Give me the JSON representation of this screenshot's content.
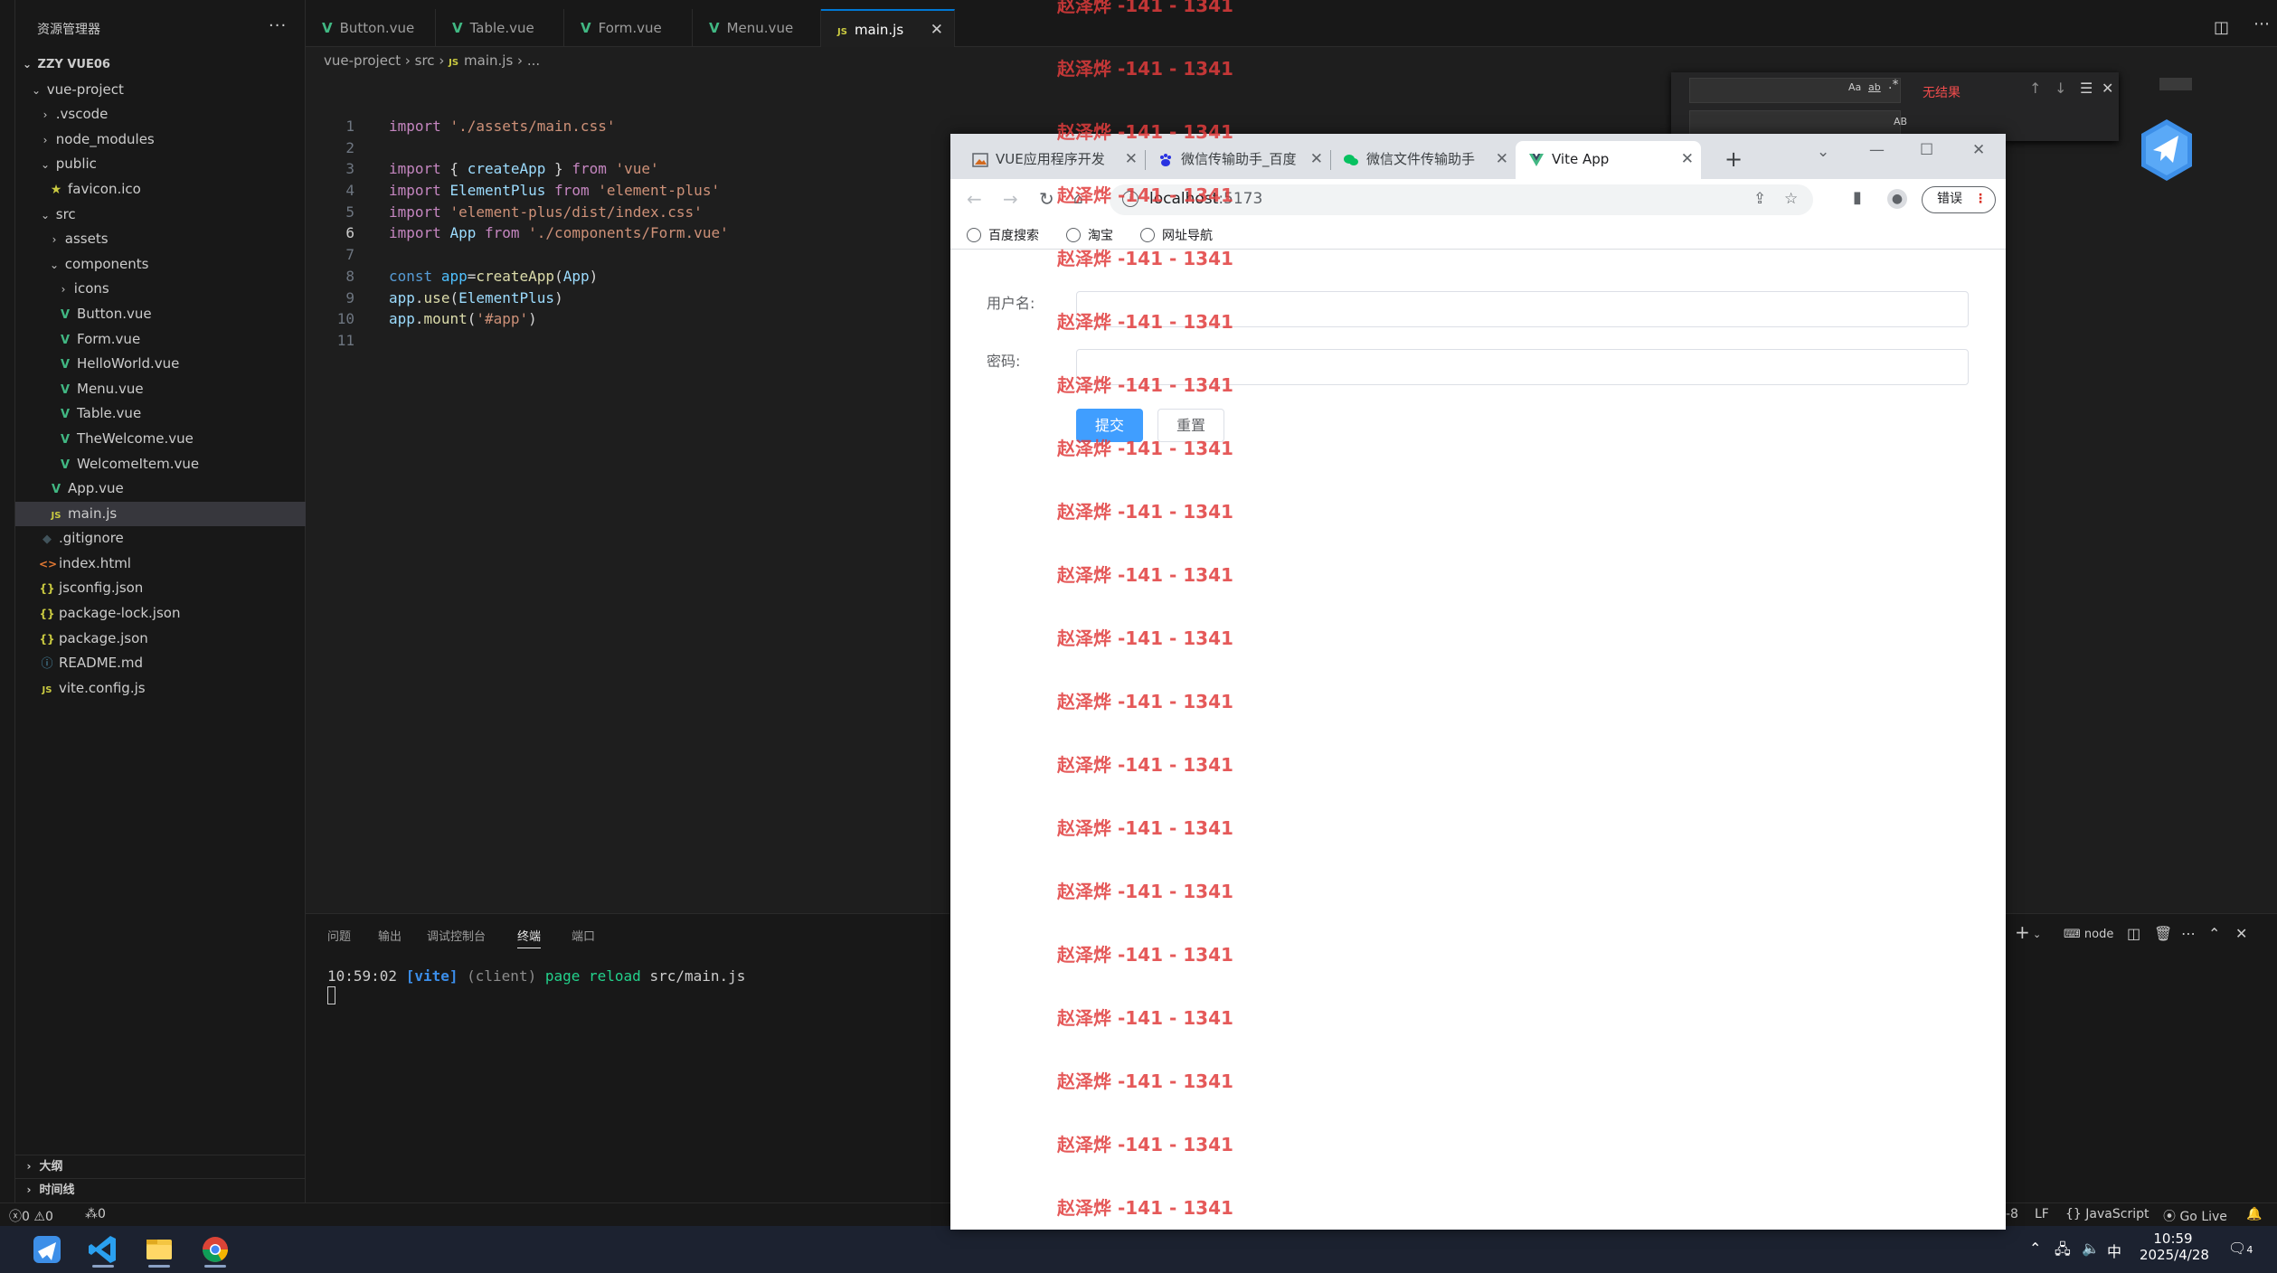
{
  "explorer": {
    "title": "资源管理器",
    "more": "···",
    "tree": [
      {
        "label": "ZZY VUE06",
        "depth": 0,
        "kind": "root",
        "expanded": true
      },
      {
        "label": "vue-project",
        "depth": 1,
        "kind": "folder",
        "expanded": true
      },
      {
        "label": ".vscode",
        "depth": 2,
        "kind": "folder",
        "expanded": false
      },
      {
        "label": "node_modules",
        "depth": 2,
        "kind": "folder",
        "expanded": false
      },
      {
        "label": "public",
        "depth": 2,
        "kind": "folder",
        "expanded": true
      },
      {
        "label": "favicon.ico",
        "depth": 3,
        "kind": "star"
      },
      {
        "label": "src",
        "depth": 2,
        "kind": "folder",
        "expanded": true
      },
      {
        "label": "assets",
        "depth": 3,
        "kind": "folder",
        "expanded": false
      },
      {
        "label": "components",
        "depth": 3,
        "kind": "folder",
        "expanded": true
      },
      {
        "label": "icons",
        "depth": 4,
        "kind": "folder",
        "expanded": false
      },
      {
        "label": "Button.vue",
        "depth": 4,
        "kind": "vue"
      },
      {
        "label": "Form.vue",
        "depth": 4,
        "kind": "vue"
      },
      {
        "label": "HelloWorld.vue",
        "depth": 4,
        "kind": "vue"
      },
      {
        "label": "Menu.vue",
        "depth": 4,
        "kind": "vue"
      },
      {
        "label": "Table.vue",
        "depth": 4,
        "kind": "vue"
      },
      {
        "label": "TheWelcome.vue",
        "depth": 4,
        "kind": "vue"
      },
      {
        "label": "WelcomeItem.vue",
        "depth": 4,
        "kind": "vue"
      },
      {
        "label": "App.vue",
        "depth": 3,
        "kind": "vue"
      },
      {
        "label": "main.js",
        "depth": 3,
        "kind": "js",
        "selected": true
      },
      {
        "label": ".gitignore",
        "depth": 2,
        "kind": "git"
      },
      {
        "label": "index.html",
        "depth": 2,
        "kind": "html"
      },
      {
        "label": "jsconfig.json",
        "depth": 2,
        "kind": "json"
      },
      {
        "label": "package-lock.json",
        "depth": 2,
        "kind": "json"
      },
      {
        "label": "package.json",
        "depth": 2,
        "kind": "json"
      },
      {
        "label": "README.md",
        "depth": 2,
        "kind": "md"
      },
      {
        "label": "vite.config.js",
        "depth": 2,
        "kind": "js"
      }
    ],
    "outline": "大纲",
    "timeline": "时间线"
  },
  "editor": {
    "tabs": [
      {
        "label": "Button.vue",
        "kind": "vue"
      },
      {
        "label": "Table.vue",
        "kind": "vue"
      },
      {
        "label": "Form.vue",
        "kind": "vue"
      },
      {
        "label": "Menu.vue",
        "kind": "vue"
      },
      {
        "label": "main.js",
        "kind": "js",
        "active": true
      }
    ],
    "breadcrumb": [
      "vue-project",
      "src",
      "main.js",
      "..."
    ],
    "code": [
      "import './assets/main.css'",
      "",
      "import { createApp } from 'vue'",
      "import ElementPlus from 'element-plus'",
      "import 'element-plus/dist/index.css'",
      "import App from './components/Form.vue'",
      "",
      "const app=createApp(App)",
      "app.use(ElementPlus)",
      "app.mount('#app')",
      ""
    ],
    "current_line": 6,
    "find": {
      "match_case": "Aa",
      "whole_word": "ab",
      "regex": ".*",
      "preserve_case": "AB",
      "no_results": "无结果"
    }
  },
  "panel": {
    "tabs": [
      "问题",
      "输出",
      "调试控制台",
      "终端",
      "端口"
    ],
    "active_tab": "终端",
    "terminal_line": {
      "time": "10:59:02",
      "tag": "[vite]",
      "scope": "(client)",
      "action": "page reload",
      "file": "src/main.js"
    },
    "shell": "node"
  },
  "status": {
    "errors": "0",
    "warnings": "0",
    "ports": "0",
    "encoding": "-8",
    "eol": "LF",
    "language": "JavaScript",
    "golive": "Go Live"
  },
  "taskbar": {
    "time": "10:59",
    "date": "2025/4/28",
    "ime": "中",
    "notif": "4"
  },
  "browser": {
    "tabs": [
      {
        "title": "VUE应用程序开发",
        "icon": "img"
      },
      {
        "title": "微信传输助手_百度",
        "icon": "baidu"
      },
      {
        "title": "微信文件传输助手",
        "icon": "wechat"
      },
      {
        "title": "Vite App",
        "icon": "vue",
        "active": true
      }
    ],
    "url_host": "localhost",
    "url_port": ":5173",
    "error_button": "错误",
    "bookmarks": [
      "百度搜索",
      "淘宝",
      "网址导航"
    ],
    "form": {
      "username_label": "用户名:",
      "password_label": "密码:",
      "submit": "提交",
      "reset": "重置"
    },
    "accent": "#409eff"
  },
  "watermark": "赵泽烨 -141 - 1341"
}
